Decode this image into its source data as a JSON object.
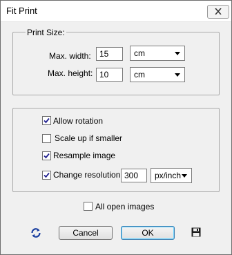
{
  "window": {
    "title": "Fit Print"
  },
  "print_size": {
    "legend": "Print Size:",
    "max_width_label": "Max. width:",
    "max_width_value": "15",
    "max_width_unit": "cm",
    "max_height_label": "Max. height:",
    "max_height_value": "10",
    "max_height_unit": "cm"
  },
  "options": {
    "allow_rotation": {
      "label": "Allow rotation",
      "checked": true
    },
    "scale_up": {
      "label": "Scale up if smaller",
      "checked": false
    },
    "resample": {
      "label": "Resample image",
      "checked": true
    },
    "change_resolution": {
      "label": "Change resolution",
      "checked": true,
      "value": "300",
      "unit": "px/inch"
    }
  },
  "all_open_images": {
    "label": "All open images",
    "checked": false
  },
  "buttons": {
    "cancel": "Cancel",
    "ok": "OK"
  },
  "icons": {
    "refresh": "refresh-icon",
    "save": "save-icon",
    "close": "close-icon"
  }
}
